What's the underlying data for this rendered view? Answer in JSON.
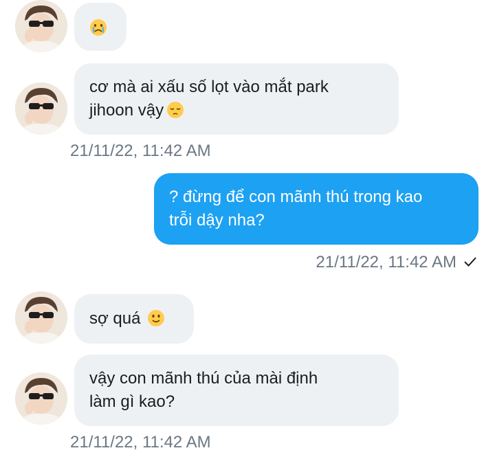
{
  "messages": [
    {
      "side": "in",
      "text": "",
      "emoji": "crying-face"
    },
    {
      "side": "in",
      "text": "cơ mà ai xấu số lọt vào mắt park\njihoon vậy",
      "emoji": "pensive-face",
      "timestamp": "21/11/22, 11:42 AM"
    },
    {
      "side": "out",
      "text": "? đừng để con mãnh thú trong kao\ntrỗi dậy nha?",
      "timestamp": "21/11/22, 11:42 AM",
      "status": "sent-check"
    },
    {
      "side": "in",
      "text": "sợ quá",
      "emoji": "slightly-smiling-face"
    },
    {
      "side": "in",
      "text": "vậy con mãnh thú của mài định\nlàm gì kao?",
      "timestamp": "21/11/22, 11:42 AM"
    }
  ],
  "colors": {
    "incoming_bubble": "#eef1f4",
    "outgoing_bubble": "#1da1f2",
    "timestamp_text": "#6b7784"
  }
}
